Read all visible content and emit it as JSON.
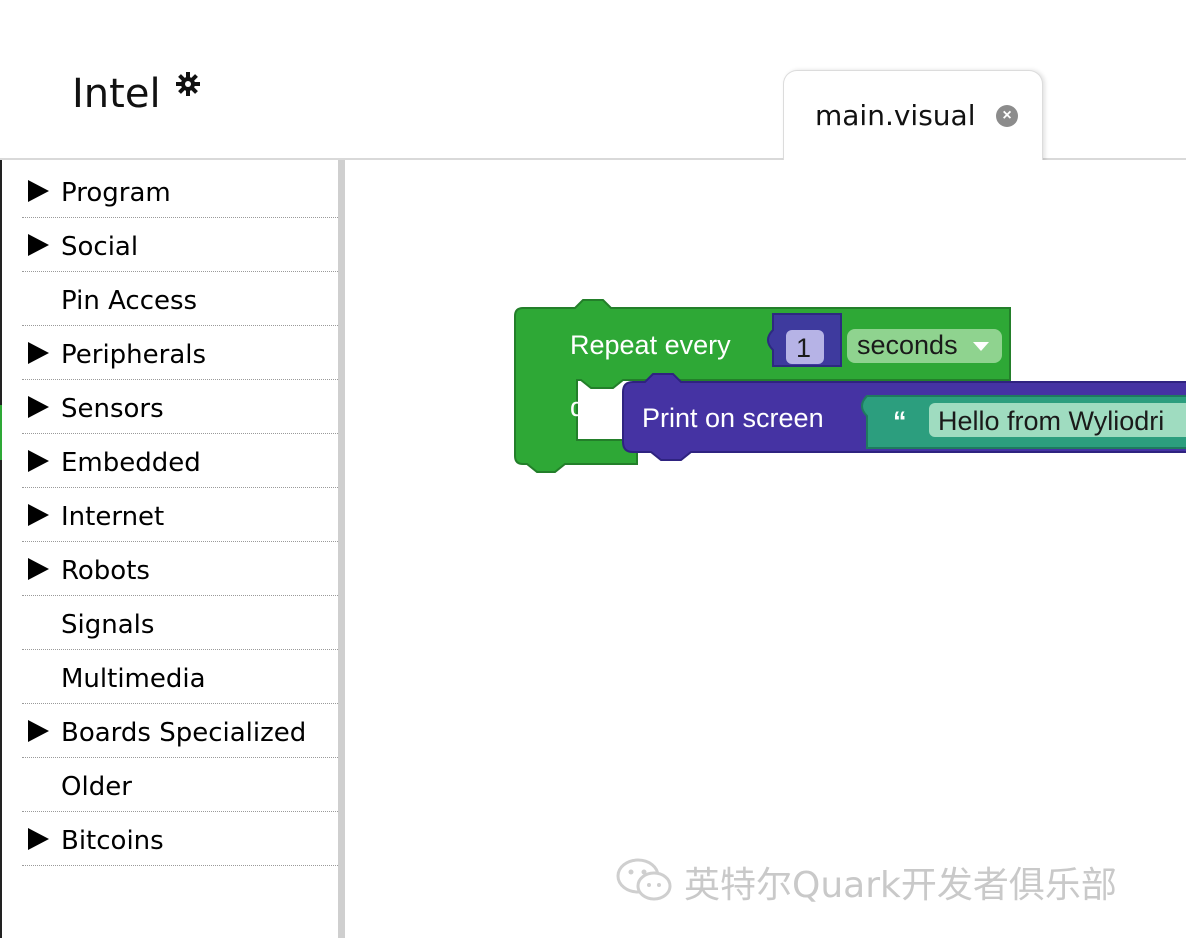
{
  "header": {
    "app_title": "Intel"
  },
  "tab": {
    "label": "main.visual",
    "close_glyph": "×"
  },
  "sidebar": {
    "items": [
      {
        "label": "Program",
        "expandable": true
      },
      {
        "label": "Social",
        "expandable": true
      },
      {
        "label": "Pin Access",
        "expandable": false
      },
      {
        "label": "Peripherals",
        "expandable": true
      },
      {
        "label": "Sensors",
        "expandable": true
      },
      {
        "label": "Embedded",
        "expandable": true
      },
      {
        "label": "Internet",
        "expandable": true
      },
      {
        "label": "Robots",
        "expandable": true
      },
      {
        "label": "Signals",
        "expandable": false
      },
      {
        "label": "Multimedia",
        "expandable": false
      },
      {
        "label": "Boards Specialized",
        "expandable": true
      },
      {
        "label": "Older",
        "expandable": false
      },
      {
        "label": "Bitcoins",
        "expandable": true
      }
    ]
  },
  "blocks": {
    "repeat": {
      "label": "Repeat every",
      "value": "1",
      "unit": "seconds",
      "do_label": "do"
    },
    "print": {
      "label": "Print on screen",
      "quote": "“",
      "text": "Hello from Wyliodri"
    }
  },
  "colors": {
    "repeat_block": "#2ea836",
    "repeat_block_dark": "#237f2a",
    "number_block": "#3e3a9e",
    "print_block": "#4533a3",
    "text_block": "#2c9e7e",
    "text_field": "#9fdcc0"
  },
  "watermark": {
    "text": "英特尔Quark开发者俱乐部",
    "icon": "wechat-icon"
  }
}
